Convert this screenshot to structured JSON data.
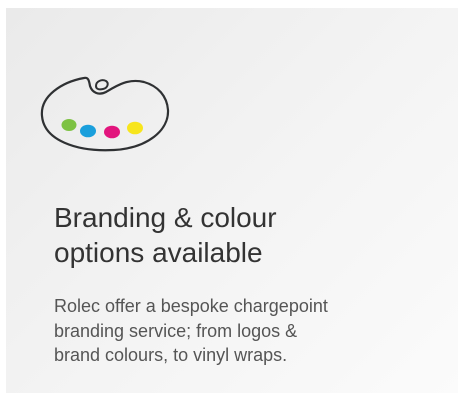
{
  "card": {
    "icon": "palette-icon",
    "title_lines": [
      "Branding & colour",
      "options available"
    ],
    "description_lines": [
      "Rolec offer a bespoke chargepoint",
      "branding service; from logos &",
      "brand colours, to vinyl wraps."
    ]
  },
  "colors": {
    "card_background": "#eeeeee",
    "title_text": "#333333",
    "body_text": "#555555",
    "icon_stroke": "#2f3133",
    "paint_green": "#7dc243",
    "paint_blue": "#1a9fdc",
    "paint_magenta": "#e2157d",
    "paint_yellow": "#f7e51c"
  }
}
